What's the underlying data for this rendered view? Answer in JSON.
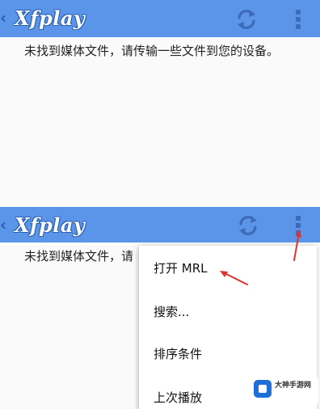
{
  "top_panel": {
    "app_bar": {
      "back_glyph": "‹",
      "title": "Xfplay",
      "refresh_icon": "refresh-icon",
      "overflow_icon": "overflow-menu-icon"
    },
    "empty_message": "未找到媒体文件，请传输一些文件到您的设备。"
  },
  "bottom_panel": {
    "app_bar": {
      "back_glyph": "‹",
      "title": "Xfplay",
      "refresh_icon": "refresh-icon",
      "overflow_icon": "overflow-menu-icon"
    },
    "empty_message": "未找到媒体文件，请",
    "menu": {
      "items": [
        {
          "label": "打开 MRL"
        },
        {
          "label": "搜索..."
        },
        {
          "label": "排序条件"
        },
        {
          "label": "上次播放"
        }
      ]
    }
  },
  "watermark": {
    "title": "大神手游网",
    "subtitle": ""
  },
  "colors": {
    "app_bar": "#5b95ea",
    "icon": "#3d6bb8",
    "annotation_arrow": "#e0312b"
  }
}
